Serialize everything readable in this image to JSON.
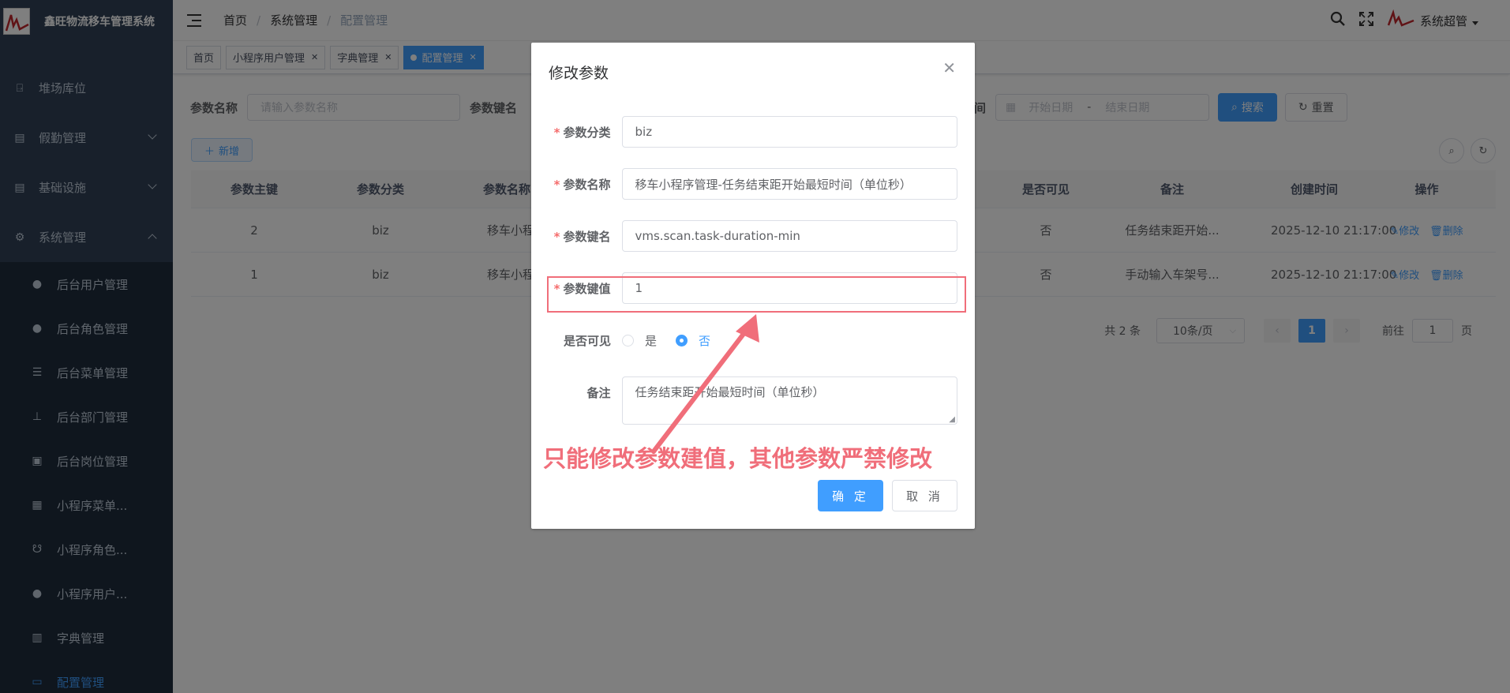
{
  "app": {
    "title": "鑫旺物流移车管理系统"
  },
  "sidebar": {
    "items": [
      {
        "label": "堆场库位",
        "icon": "lock-icon"
      },
      {
        "label": "假勤管理",
        "icon": "document-icon"
      },
      {
        "label": "基础设施",
        "icon": "document-icon"
      },
      {
        "label": "系统管理",
        "icon": "gear-icon"
      }
    ],
    "subitems": [
      {
        "label": "后台用户管理",
        "icon": "user-icon"
      },
      {
        "label": "后台角色管理",
        "icon": "user-group-icon"
      },
      {
        "label": "后台菜单管理",
        "icon": "list-icon"
      },
      {
        "label": "后台部门管理",
        "icon": "tree-icon"
      },
      {
        "label": "后台岗位管理",
        "icon": "post-icon"
      },
      {
        "label": "小程序菜单...",
        "icon": "grid-icon"
      },
      {
        "label": "小程序角色...",
        "icon": "peoples-icon"
      },
      {
        "label": "小程序用户...",
        "icon": "user-icon"
      },
      {
        "label": "字典管理",
        "icon": "dict-icon"
      },
      {
        "label": "配置管理",
        "icon": "edit-icon"
      }
    ]
  },
  "navbar": {
    "breadcrumb": [
      "首页",
      "系统管理",
      "配置管理"
    ],
    "user_name": "系统超管"
  },
  "tags": [
    {
      "label": "首页",
      "closable": false
    },
    {
      "label": "小程序用户管理",
      "closable": true
    },
    {
      "label": "字典管理",
      "closable": true
    },
    {
      "label": "配置管理",
      "closable": true,
      "active": true
    }
  ],
  "search": {
    "name_label": "参数名称",
    "name_placeholder": "请输入参数名称",
    "key_label": "参数键名",
    "time_label": "创建时间",
    "start_placeholder": "开始日期",
    "range_sep": "-",
    "end_placeholder": "结束日期",
    "search_button": "搜索",
    "reset_button": "重置"
  },
  "toolbar": {
    "add_button": "新增"
  },
  "table": {
    "headers": [
      "参数主键",
      "参数分类",
      "参数名称",
      "是否可见",
      "备注",
      "创建时间",
      "操作"
    ],
    "rows": [
      {
        "id": "2",
        "category": "biz",
        "name": "移车小程序管理",
        "visible": "否",
        "remark": "任务结束距开始...",
        "created": "2025-12-10 21:17:00"
      },
      {
        "id": "1",
        "category": "biz",
        "name": "移车小程序管理",
        "visible": "否",
        "remark": "手动输入车架号...",
        "created": "2025-12-10 21:17:00"
      }
    ],
    "edit_label": "修改",
    "delete_label": "删除"
  },
  "pagination": {
    "total": "共 2 条",
    "page_size": "10条/页",
    "current": "1",
    "goto_label": "前往",
    "goto_value": "1",
    "page_unit": "页"
  },
  "dialog": {
    "title": "修改参数",
    "fields": {
      "category_label": "参数分类",
      "category_value": "biz",
      "name_label": "参数名称",
      "name_value": "移车小程序管理-任务结束距开始最短时间（单位秒）",
      "key_label": "参数键名",
      "key_value": "vms.scan.task-duration-min",
      "value_label": "参数键值",
      "value_value": "1",
      "visible_label": "是否可见",
      "visible_yes": "是",
      "visible_no": "否",
      "remark_label": "备注",
      "remark_value": "任务结束距开始最短时间（单位秒）"
    },
    "annotation": "只能修改参数建值，其他参数严禁修改",
    "confirm_button": "确 定",
    "cancel_button": "取 消"
  },
  "colors": {
    "primary": "#409eff",
    "sidebar_bg": "#304156",
    "annotation": "#f06e7a"
  }
}
